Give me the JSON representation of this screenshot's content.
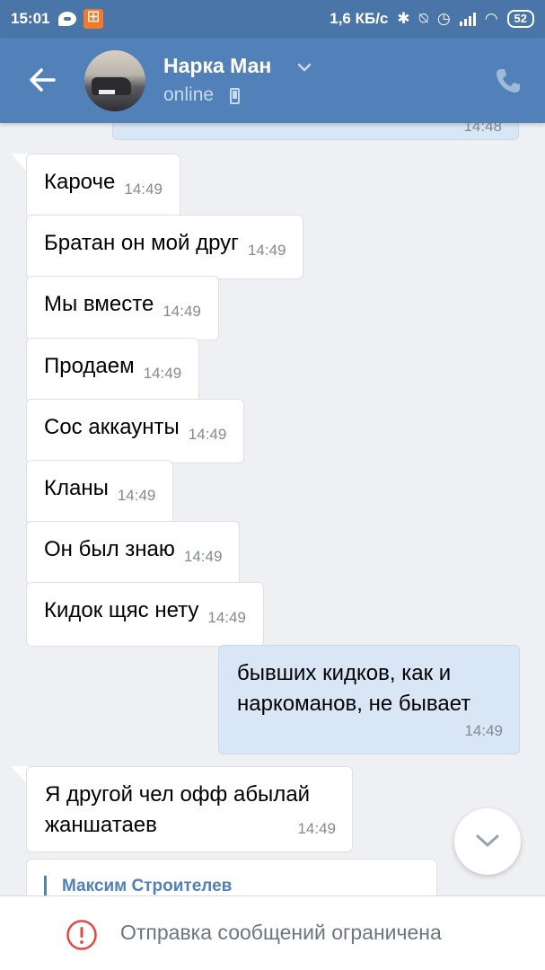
{
  "status_bar": {
    "time": "15:01",
    "network_speed": "1,6 КБ/с",
    "battery": "52"
  },
  "header": {
    "contact_name": "Нарка Ман",
    "status": "online"
  },
  "messages": {
    "partial_top_time": "14:48",
    "items": [
      {
        "text": "Кароче",
        "time": "14:49",
        "direction": "in"
      },
      {
        "text": "Братан он мой друг",
        "time": "14:49",
        "direction": "in"
      },
      {
        "text": "Мы вместе",
        "time": "14:49",
        "direction": "in"
      },
      {
        "text": "Продаем",
        "time": "14:49",
        "direction": "in"
      },
      {
        "text": "Сос аккаунты",
        "time": "14:49",
        "direction": "in"
      },
      {
        "text": "Кланы",
        "time": "14:49",
        "direction": "in"
      },
      {
        "text": "Он был знаю",
        "time": "14:49",
        "direction": "in"
      },
      {
        "text": "Кидок щяс нету",
        "time": "14:49",
        "direction": "in"
      },
      {
        "text_line1": "бывших кидков, как и",
        "text_line2": "наркоманов, не бывает",
        "time": "14:49",
        "direction": "out"
      },
      {
        "text_line1": "Я другой чел офф абылай",
        "text_line2": "жаншатаев",
        "time": "14:49",
        "direction": "in"
      }
    ],
    "forwarded_author": "Максим Строителев"
  },
  "footer": {
    "notice": "Отправка сообщений ограничена"
  },
  "colors": {
    "header_bg": "#5181b8",
    "status_bar_bg": "#4a75a8",
    "outgoing_bubble": "#d8e6f5",
    "incoming_bubble": "#ffffff",
    "warning_red": "#e64646"
  },
  "icons": [
    "back-arrow-icon",
    "chevron-down-icon",
    "phone-icon",
    "call-icon",
    "chevron-down-icon",
    "warning-icon"
  ]
}
